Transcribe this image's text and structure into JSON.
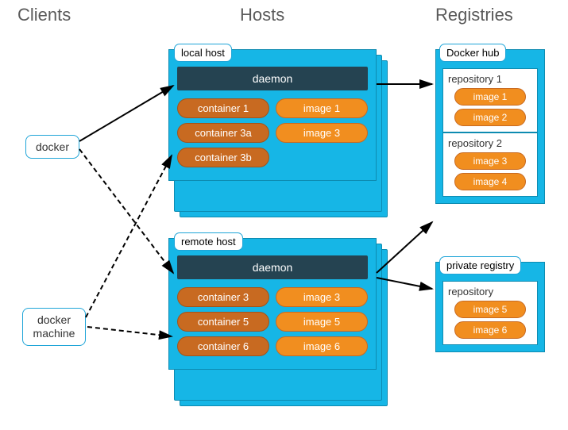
{
  "headers": {
    "clients": "Clients",
    "hosts": "Hosts",
    "registries": "Registries"
  },
  "clients": {
    "docker": "docker",
    "machine": "docker\nmachine"
  },
  "hosts": {
    "local": {
      "label": "local host",
      "daemon": "daemon",
      "containers": [
        "container 1",
        "container 3a",
        "container 3b"
      ],
      "images": [
        "image 1",
        "image 3"
      ]
    },
    "remote": {
      "label": "remote host",
      "daemon": "daemon",
      "containers": [
        "container 3",
        "container 5",
        "container 6"
      ],
      "images": [
        "image 3",
        "image 5",
        "image 6"
      ]
    }
  },
  "registries": {
    "hub": {
      "label": "Docker hub",
      "repos": [
        {
          "name": "repository 1",
          "images": [
            "image 1",
            "image 2"
          ]
        },
        {
          "name": "repository 2",
          "images": [
            "image 3",
            "image 4"
          ]
        }
      ]
    },
    "private": {
      "label": "private registry",
      "repos": [
        {
          "name": "repository",
          "images": [
            "image 5",
            "image 6"
          ]
        }
      ]
    }
  }
}
